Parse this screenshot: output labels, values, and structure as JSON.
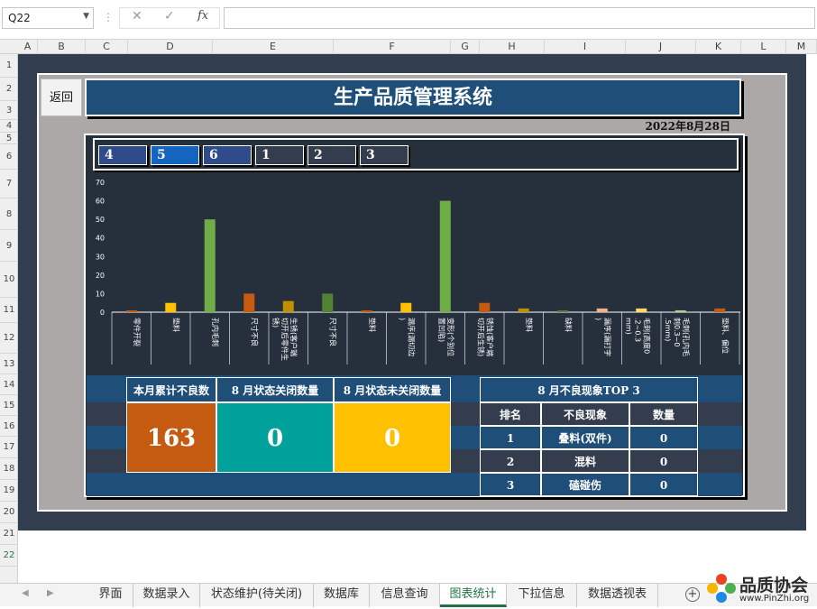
{
  "formula_bar": {
    "name_box": "Q22",
    "fx": "fx",
    "formula": ""
  },
  "columns": [
    "A",
    "B",
    "C",
    "D",
    "E",
    "F",
    "G",
    "H",
    "I",
    "J",
    "K",
    "L",
    "M"
  ],
  "rows": [
    "1",
    "2",
    "3",
    "4",
    "5",
    "6",
    "7",
    "8",
    "9",
    "10",
    "11",
    "12",
    "13",
    "14",
    "15",
    "16",
    "17",
    "18",
    "19",
    "20",
    "21",
    "22"
  ],
  "dashboard": {
    "back_button": "返回",
    "title": "生产品质管理系统",
    "date": "2022年8月28日",
    "month_tabs": [
      "4",
      "5",
      "6",
      "1",
      "2",
      "3"
    ],
    "active_tab": "5",
    "summary_headers": [
      "本月累计不良数",
      "8 月状态关闭数量",
      "8 月状态未关闭数量"
    ],
    "summary_values": [
      "163",
      "0",
      "0"
    ],
    "top3": {
      "title": "8 月不良现象TOP 3",
      "headers": [
        "排名",
        "不良现象",
        "数量"
      ],
      "rows": [
        {
          "rank": "1",
          "defect": "叠料(双件)",
          "count": "0"
        },
        {
          "rank": "2",
          "defect": "混料",
          "count": "0"
        },
        {
          "rank": "3",
          "defect": "磕碰伤",
          "count": "0"
        }
      ]
    },
    "colors": {
      "total": "#c55a11",
      "closed": "#00a19a",
      "open": "#ffc000",
      "navy": "#1f4e79",
      "panel": "#262f3c"
    }
  },
  "chart_data": {
    "type": "bar",
    "ylim": [
      0,
      70
    ],
    "yticks": [
      "0",
      "10",
      "20",
      "30",
      "40",
      "50",
      "60",
      "70"
    ],
    "categories": [
      "零件开裂",
      "垫料",
      "孔内毛刺",
      "尺寸不良",
      "生锈(客户端切开后零件生锈)",
      "尺寸不良",
      "垫料",
      "漏序(漏切边)",
      "变形(个别位置凹陷)",
      "锈蚀(客户端切开后生锈)",
      "垫料",
      "缺料",
      "漏序(漏打字)",
      "毛刺(高度0.2~0.3mm)",
      "毛刺(孔内毛刺0.3~0.5mm)",
      "垫料、偏位"
    ],
    "values": [
      1,
      5,
      50,
      10,
      6,
      10,
      1,
      5,
      60,
      5,
      2,
      1,
      2,
      2,
      1,
      2
    ],
    "colors": [
      "#c55a11",
      "#ffc000",
      "#70ad47",
      "#c55a11",
      "#bf9000",
      "#548235",
      "#c55a11",
      "#ffc000",
      "#70ad47",
      "#c55a11",
      "#bf9000",
      "#548235",
      "#f4b183",
      "#ffd966",
      "#a9d18e",
      "#c55a11"
    ]
  },
  "sheet_tabs": [
    "界面",
    "数据录入",
    "状态维护(待关闭)",
    "数据库",
    "信息查询",
    "图表统计",
    "下拉信息",
    "数据透视表"
  ],
  "active_sheet": "图表统计",
  "watermark": {
    "name": "品质协会",
    "url": "www.PinZhi.org"
  }
}
